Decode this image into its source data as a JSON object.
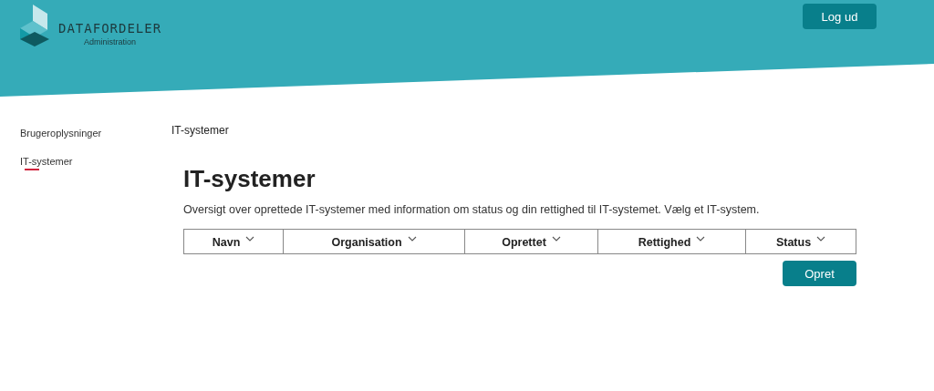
{
  "header": {
    "logo": {
      "name": "DATAFORDELER",
      "subtitle": "Administration"
    },
    "logout_button": "Log ud"
  },
  "sidebar": {
    "items": [
      {
        "label": "Brugeroplysninger",
        "selected": false
      },
      {
        "label": "IT-systemer",
        "selected": true
      }
    ]
  },
  "breadcrumb": "IT-systemer",
  "page": {
    "title": "IT-systemer",
    "description": "Oversigt over oprettede IT-systemer med information om status og din rettighed til IT-systemet. Vælg et IT-system.",
    "table": {
      "columns": [
        "Navn",
        "Organisation",
        "Oprettet",
        "Rettighed",
        "Status"
      ]
    },
    "create_button": "Opret"
  }
}
